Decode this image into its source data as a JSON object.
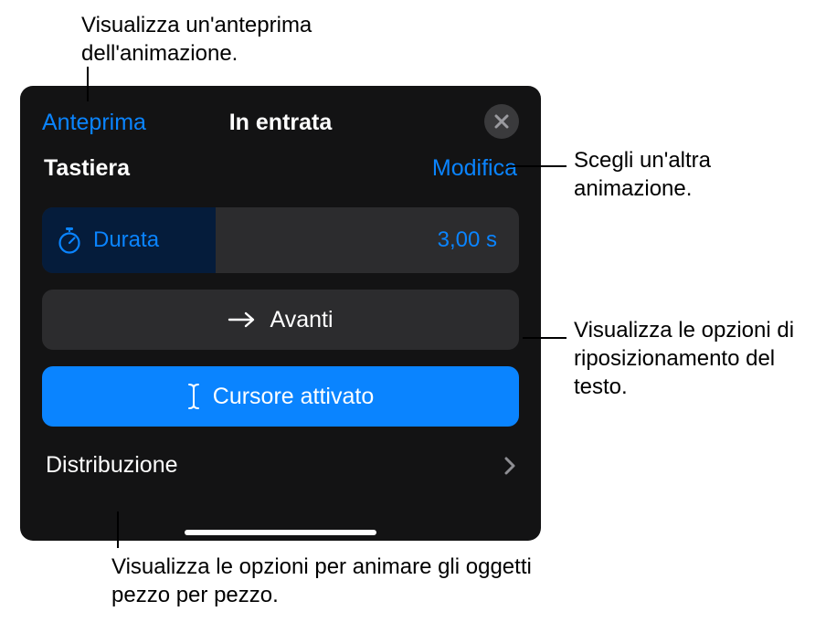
{
  "panel": {
    "preview_label": "Anteprima",
    "title": "In entrata",
    "animation_name": "Tastiera",
    "edit_label": "Modifica",
    "duration_label": "Durata",
    "duration_value": "3,00 s",
    "direction_label": "Avanti",
    "cursor_label": "Cursore attivato",
    "distribution_label": "Distribuzione"
  },
  "callouts": {
    "preview": "Visualizza un'anteprima dell'animazione.",
    "edit": "Scegli un'altra animazione.",
    "avanti": "Visualizza le opzioni di riposizionamento del testo.",
    "distribution": "Visualizza le opzioni per animare gli oggetti pezzo per pezzo."
  }
}
